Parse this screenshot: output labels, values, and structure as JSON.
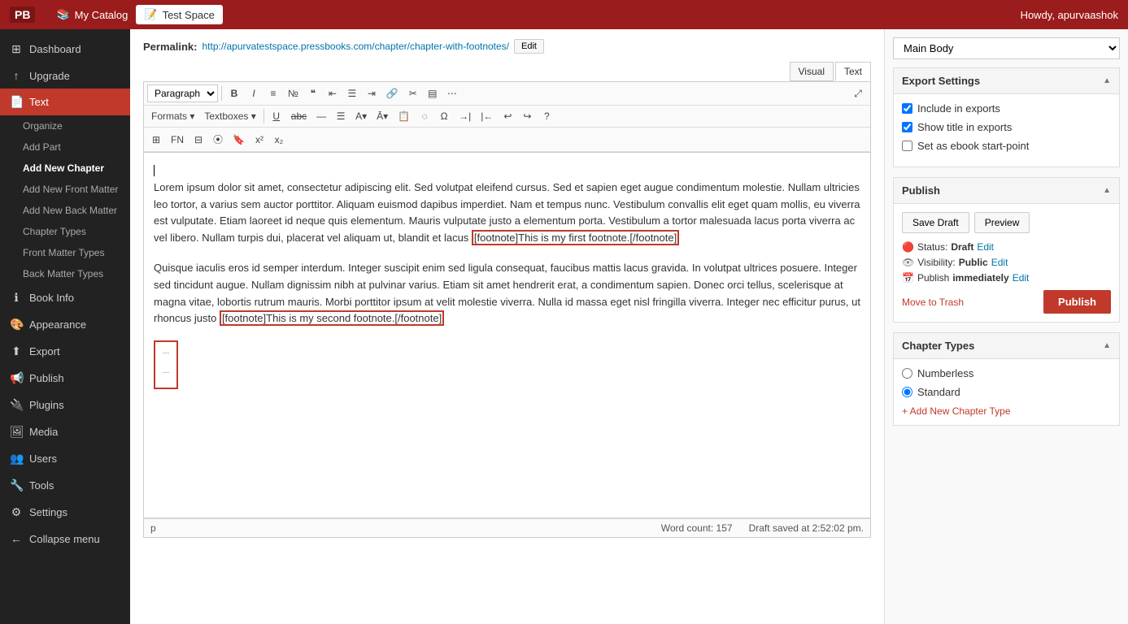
{
  "topbar": {
    "logo": "PB",
    "catalog_label": "My Catalog",
    "active_tab": "Test Space",
    "user_greeting": "Howdy, apurvaashok"
  },
  "sidebar": {
    "items": [
      {
        "id": "dashboard",
        "label": "Dashboard",
        "icon": "⊞"
      },
      {
        "id": "upgrade",
        "label": "Upgrade",
        "icon": "↑"
      },
      {
        "id": "text",
        "label": "Text",
        "icon": "📄",
        "active": true
      },
      {
        "id": "organize",
        "label": "Organize",
        "sub": true
      },
      {
        "id": "add-part",
        "label": "Add Part",
        "sub": true
      },
      {
        "id": "add-new-chapter",
        "label": "Add New Chapter",
        "sub": true,
        "bold": true
      },
      {
        "id": "add-front-matter",
        "label": "Add New Front Matter",
        "sub": true
      },
      {
        "id": "add-back-matter",
        "label": "Add New Back Matter",
        "sub": true
      },
      {
        "id": "chapter-types",
        "label": "Chapter Types",
        "sub": true
      },
      {
        "id": "front-matter-types",
        "label": "Front Matter Types",
        "sub": true
      },
      {
        "id": "back-matter-types",
        "label": "Back Matter Types",
        "sub": true
      },
      {
        "id": "book-info",
        "label": "Book Info",
        "icon": "ℹ"
      },
      {
        "id": "appearance",
        "label": "Appearance",
        "icon": "🎨"
      },
      {
        "id": "export",
        "label": "Export",
        "icon": "⬆"
      },
      {
        "id": "publish",
        "label": "Publish",
        "icon": "📢"
      },
      {
        "id": "plugins",
        "label": "Plugins",
        "icon": "🔌"
      },
      {
        "id": "media",
        "label": "Media",
        "icon": "🖼"
      },
      {
        "id": "users",
        "label": "Users",
        "icon": "👥"
      },
      {
        "id": "tools",
        "label": "Tools",
        "icon": "🔧"
      },
      {
        "id": "settings",
        "label": "Settings",
        "icon": "⚙"
      },
      {
        "id": "collapse",
        "label": "Collapse menu",
        "icon": "←"
      }
    ]
  },
  "permalink": {
    "label": "Permalink:",
    "url": "http://apurvatestspace.pressbooks.com/chapter/chapter-with-footnotes/",
    "edit_label": "Edit"
  },
  "editor": {
    "visual_tab": "Visual",
    "text_tab": "Text",
    "paragraph_select": "Paragraph",
    "formats_label": "Formats",
    "textboxes_label": "Textboxes",
    "content_para1": "Lorem ipsum dolor sit amet, consectetur adipiscing elit. Sed volutpat eleifend cursus. Sed et sapien eget augue condimentum molestie. Nullam ultricies leo tortor, a varius sem auctor porttitor. Aliquam euismod dapibus imperdiet. Nam et tempus nunc. Vestibulum convallis elit eget quam mollis, eu viverra est vulputate. Etiam laoreet id neque quis elementum. Mauris vulputate justo a elementum porta. Vestibulum a tortor malesuada lacus porta viverra ac vel libero. Nullam turpis dui, placerat vel aliquam ut, blandit et lacus ",
    "footnote1": "[footnote]This is my first footnote.[/footnote]",
    "content_para2": "Quisque iaculis eros id semper interdum. Integer suscipit enim sed ligula consequat, faucibus mattis lacus gravida. In volutpat ultrices posuere. Integer sed tincidunt augue. Nullam dignissim nibh at pulvinar varius. Etiam sit amet hendrerit erat, a condimentum sapien. Donec orci tellus, scelerisque at magna vitae, lobortis rutrum mauris. Morbi porttitor ipsum at velit molestie viverra. Nulla id massa eget nisl fringilla viverra. Integer nec efficitur purus, ut rhoncus justo ",
    "footnote2": "[footnote]This is my second footnote.[/footnote]",
    "small_block_dots1": "...",
    "small_block_dots2": "...",
    "status_tag": "p",
    "word_count_label": "Word count:",
    "word_count": "157",
    "draft_saved": "Draft saved at 2:52:02 pm."
  },
  "right_sidebar": {
    "main_body_label": "Main Body",
    "export_settings": {
      "title": "Export Settings",
      "include_exports_label": "Include in exports",
      "include_exports_checked": true,
      "show_title_label": "Show title in exports",
      "show_title_checked": true,
      "ebook_start_label": "Set as ebook start-point",
      "ebook_start_checked": false
    },
    "publish": {
      "title": "Publish",
      "save_draft_label": "Save Draft",
      "preview_label": "Preview",
      "status_label": "Status:",
      "status_value": "Draft",
      "status_edit": "Edit",
      "visibility_label": "Visibility:",
      "visibility_value": "Public",
      "visibility_edit": "Edit",
      "publish_label": "Publish",
      "publish_timing": "immediately",
      "publish_timing_edit": "Edit",
      "move_to_trash_label": "Move to Trash",
      "publish_btn_label": "Publish"
    },
    "chapter_types": {
      "title": "Chapter Types",
      "options": [
        {
          "id": "numberless",
          "label": "Numberless",
          "checked": false
        },
        {
          "id": "standard",
          "label": "Standard",
          "checked": true
        }
      ],
      "add_label": "+ Add New Chapter Type"
    }
  }
}
